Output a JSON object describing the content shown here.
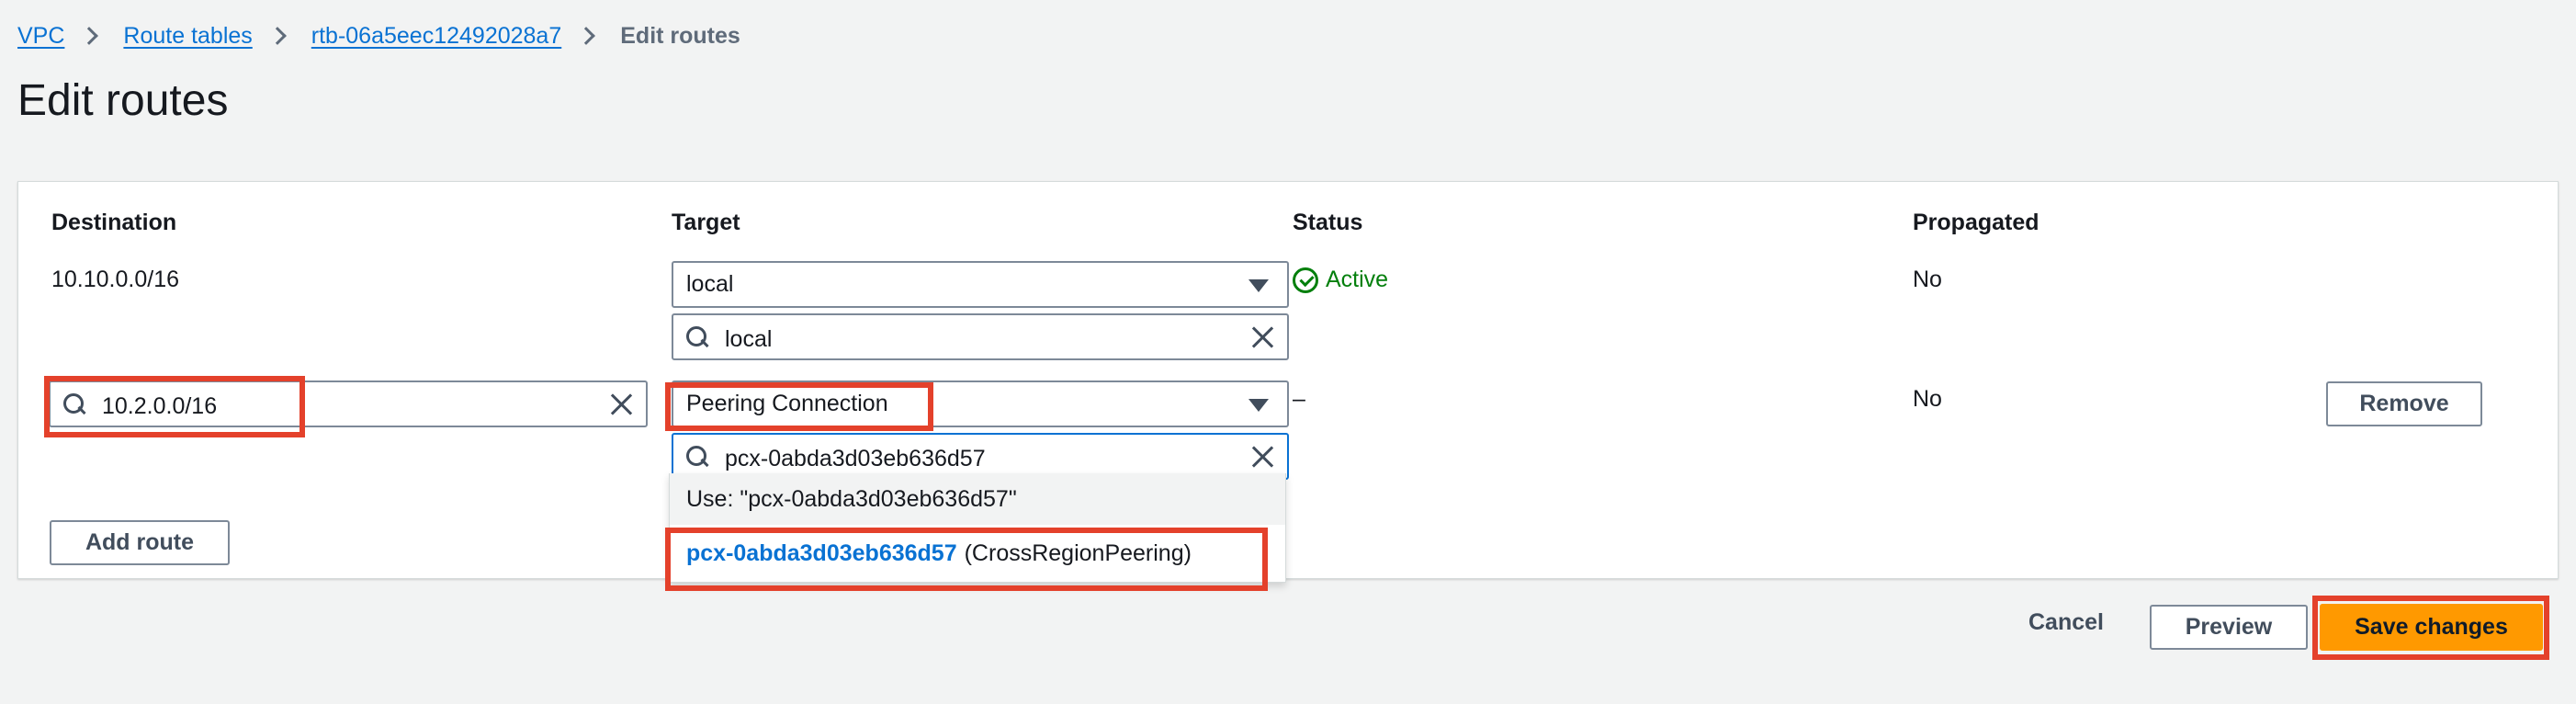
{
  "breadcrumb": {
    "items": [
      {
        "label": "VPC"
      },
      {
        "label": "Route tables"
      },
      {
        "label": "rtb-06a5eec12492028a7"
      }
    ],
    "current": "Edit routes"
  },
  "page": {
    "title": "Edit routes"
  },
  "table": {
    "headers": {
      "destination": "Destination",
      "target": "Target",
      "status": "Status",
      "propagated": "Propagated"
    },
    "rows": [
      {
        "destination": "10.10.0.0/16",
        "target_selected": "local",
        "target_filter": "local",
        "status": "Active",
        "propagated": "No"
      },
      {
        "destination": "10.2.0.0/16",
        "target_selected": "Peering Connection",
        "target_filter": "pcx-0abda3d03eb636d57",
        "status": "–",
        "propagated": "No",
        "remove_label": "Remove"
      }
    ]
  },
  "dropdown": {
    "use_option": "Use: \"pcx-0abda3d03eb636d57\"",
    "option_id": "pcx-0abda3d03eb636d57",
    "option_desc": "(CrossRegionPeering)"
  },
  "add_route_label": "Add route",
  "footer": {
    "cancel_label": "Cancel",
    "preview_label": "Preview",
    "save_label": "Save changes"
  },
  "colors": {
    "accent_link": "#0972d3",
    "status_active": "#037f0c",
    "primary_button": "#ff9900",
    "highlight_box": "#e4412b"
  },
  "icons": [
    "chevron-right-icon",
    "search-icon",
    "clear-icon",
    "caret-down-icon",
    "check-circle-icon"
  ]
}
